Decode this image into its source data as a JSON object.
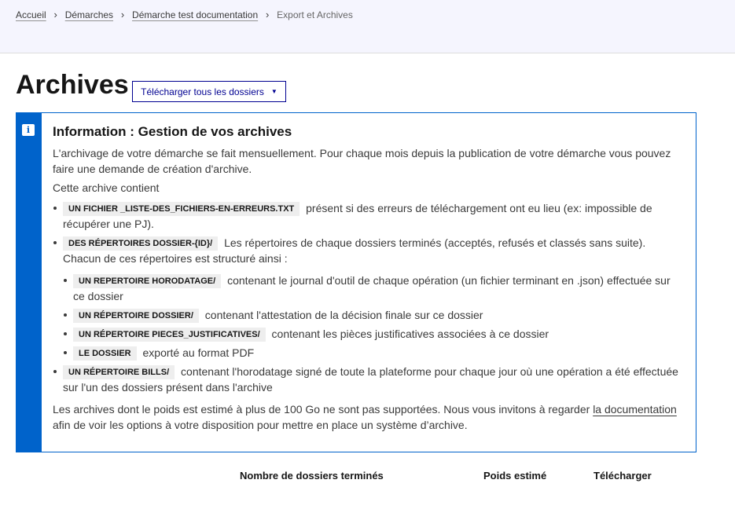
{
  "breadcrumb": {
    "items": [
      "Accueil",
      "Démarches",
      "Démarche test documentation"
    ],
    "current": "Export et Archives"
  },
  "page": {
    "title": "Archives",
    "download_all_label": "Télécharger tous les dossiers"
  },
  "notice": {
    "icon": "info-icon",
    "title": "Information : Gestion de vos archives",
    "intro": "L'archivage de votre démarche se fait mensuellement. Pour chaque mois depuis la publication de votre démarche vous pouvez faire une demande de création d'archive.",
    "contains": "Cette archive contient",
    "items": [
      {
        "code": "UN FICHIER _LISTE-DES_FICHIERS-EN-ERREURS.TXT",
        "text": "présent si des erreurs de téléchargement ont eu lieu (ex: impossible de récupérer une PJ)."
      },
      {
        "code": "DES RÉPERTOIRES DOSSIER-{ID}/",
        "text": "Les répertoires de chaque dossiers terminés (acceptés, refusés et classés sans suite). Chacun de ces répertoires est structuré ainsi :"
      },
      {
        "code": "UN RÉPERTOIRE BILLS/",
        "text": "contenant l'horodatage signé de toute la plateforme pour chaque jour où une opération a été effectuée sur l'un des dossiers présent dans l'archive"
      }
    ],
    "subitems": [
      {
        "code": "UN REPERTOIRE HORODATAGE/",
        "text": "contenant le journal d'outil de chaque opération (un fichier terminant en .json) effectuée sur ce dossier"
      },
      {
        "code": "UN RÉPERTOIRE DOSSIER/",
        "text": "contenant l'attestation de la décision finale sur ce dossier"
      },
      {
        "code": "UN RÉPERTOIRE PIECES_JUSTIFICATIVES/",
        "text": "contenant les pièces justificatives associées à ce dossier"
      },
      {
        "code": "LE DOSSIER",
        "text": "exporté au format PDF"
      }
    ],
    "footer_before": "Les archives dont le poids est estimé à plus de 100 Go ne sont pas supportées. Nous vous invitons à regarder ",
    "footer_link": "la documentation",
    "footer_after": " afin de voir les options à votre disposition pour mettre en place un système d’archive."
  },
  "table": {
    "headers": [
      "Nombre de dossiers terminés",
      "Poids estimé",
      "Télécharger"
    ]
  },
  "colors": {
    "primary": "#000091",
    "info": "#0063cb",
    "header_bg": "#f5f5fe"
  }
}
